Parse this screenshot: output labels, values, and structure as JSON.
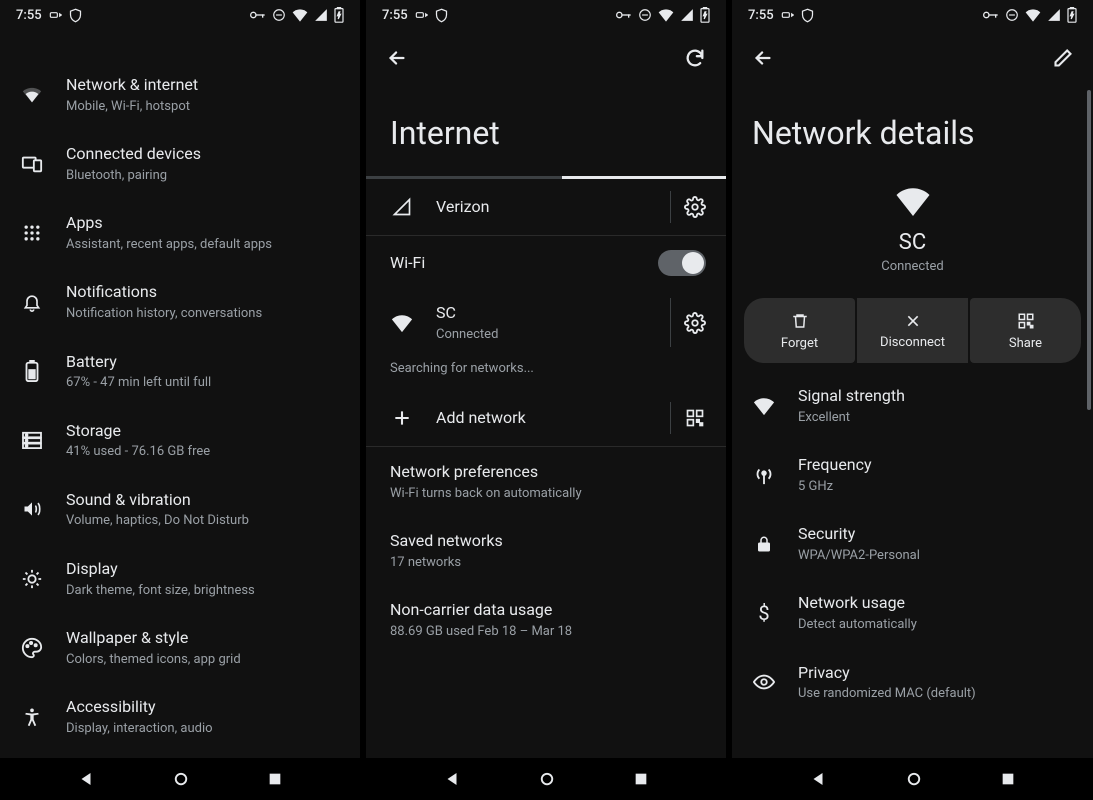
{
  "status": {
    "time": "7:55"
  },
  "screen1": {
    "items": [
      {
        "icon": "wifi",
        "title": "Network & internet",
        "sub": "Mobile, Wi-Fi, hotspot"
      },
      {
        "icon": "devices",
        "title": "Connected devices",
        "sub": "Bluetooth, pairing"
      },
      {
        "icon": "apps",
        "title": "Apps",
        "sub": "Assistant, recent apps, default apps"
      },
      {
        "icon": "bell",
        "title": "Notifications",
        "sub": "Notification history, conversations"
      },
      {
        "icon": "battery",
        "title": "Battery",
        "sub": "67% - 47 min left until full"
      },
      {
        "icon": "storage",
        "title": "Storage",
        "sub": "41% used - 76.16 GB free"
      },
      {
        "icon": "sound",
        "title": "Sound & vibration",
        "sub": "Volume, haptics, Do Not Disturb"
      },
      {
        "icon": "display",
        "title": "Display",
        "sub": "Dark theme, font size, brightness"
      },
      {
        "icon": "wallpaper",
        "title": "Wallpaper & style",
        "sub": "Colors, themed icons, app grid"
      },
      {
        "icon": "accessibility",
        "title": "Accessibility",
        "sub": "Display, interaction, audio"
      }
    ]
  },
  "screen2": {
    "title": "Internet",
    "carrier": "Verizon",
    "wifi_label": "Wi-Fi",
    "network": {
      "name": "SC",
      "status": "Connected"
    },
    "searching": "Searching for networks...",
    "add_network": "Add network",
    "prefs": {
      "title": "Network preferences",
      "sub": "Wi-Fi turns back on automatically"
    },
    "saved": {
      "title": "Saved networks",
      "sub": "17 networks"
    },
    "usage": {
      "title": "Non-carrier data usage",
      "sub": "88.69 GB used Feb 18 – Mar 18"
    }
  },
  "screen3": {
    "title": "Network details",
    "network": {
      "name": "SC",
      "status": "Connected"
    },
    "actions": {
      "forget": "Forget",
      "disconnect": "Disconnect",
      "share": "Share"
    },
    "details": [
      {
        "icon": "wifi",
        "title": "Signal strength",
        "sub": "Excellent"
      },
      {
        "icon": "freq",
        "title": "Frequency",
        "sub": "5 GHz"
      },
      {
        "icon": "lock",
        "title": "Security",
        "sub": "WPA/WPA2-Personal"
      },
      {
        "icon": "dollar",
        "title": "Network usage",
        "sub": "Detect automatically"
      },
      {
        "icon": "eye",
        "title": "Privacy",
        "sub": "Use randomized MAC (default)"
      }
    ]
  }
}
